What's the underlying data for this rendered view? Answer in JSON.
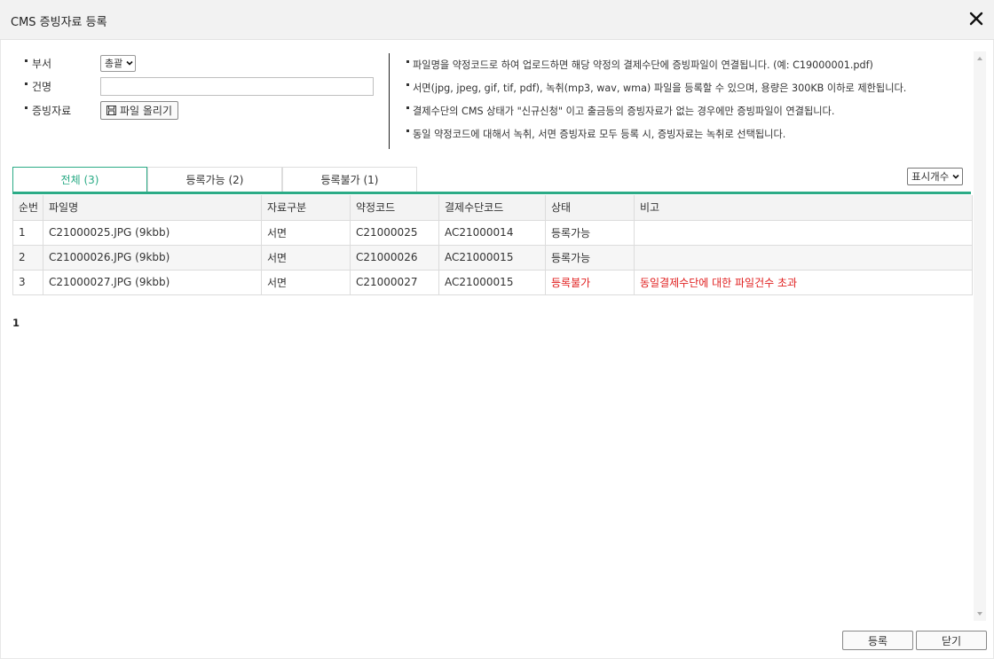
{
  "window": {
    "title": "CMS 증빙자료 등록"
  },
  "form": {
    "dept_label": "부서",
    "dept_value": "총괄",
    "name_label": "건명",
    "name_value": "",
    "evidence_label": "증빙자료",
    "upload_label": "파일 올리기"
  },
  "notices": [
    "파일명을 약정코드로 하여 업로드하면 해당 약정의 결제수단에 증빙파일이 연결됩니다. (예: C19000001.pdf)",
    "서면(jpg, jpeg, gif, tif, pdf), 녹취(mp3, wav, wma) 파일을 등록할 수 있으며, 용량은 300KB 이하로 제한됩니다.",
    "결제수단의 CMS 상태가 \"신규신청\" 이고 출금등의 증빙자료가 없는 경우에만 증빙파일이 연결됩니다.",
    "동일 약정코드에 대해서 녹취, 서면 증빙자료 모두 등록 시, 증빙자료는 녹취로 선택됩니다."
  ],
  "tabs": [
    {
      "label": "전체 (3)",
      "active": true
    },
    {
      "label": "등록가능 (2)",
      "active": false
    },
    {
      "label": "등록불가 (1)",
      "active": false
    }
  ],
  "display_count_label": "표시개수",
  "table": {
    "headers": [
      "순번",
      "파일명",
      "자료구분",
      "약정코드",
      "결제수단코드",
      "상태",
      "비고"
    ],
    "rows": [
      [
        "1",
        "C21000025.JPG (9kbb)",
        "서면",
        "C21000025",
        "AC21000014",
        "등록가능",
        ""
      ],
      [
        "2",
        "C21000026.JPG (9kbb)",
        "서면",
        "C21000026",
        "AC21000015",
        "등록가능",
        ""
      ],
      [
        "3",
        "C21000027.JPG (9kbb)",
        "서면",
        "C21000027",
        "AC21000015",
        "등록불가",
        "동일결제수단에 대한 파일건수 초과"
      ]
    ]
  },
  "pagination": {
    "current_page": "1"
  },
  "buttons": {
    "register": "등록",
    "close": "닫기"
  },
  "colors": {
    "accent": "#2bab86",
    "error": "#e02020"
  }
}
